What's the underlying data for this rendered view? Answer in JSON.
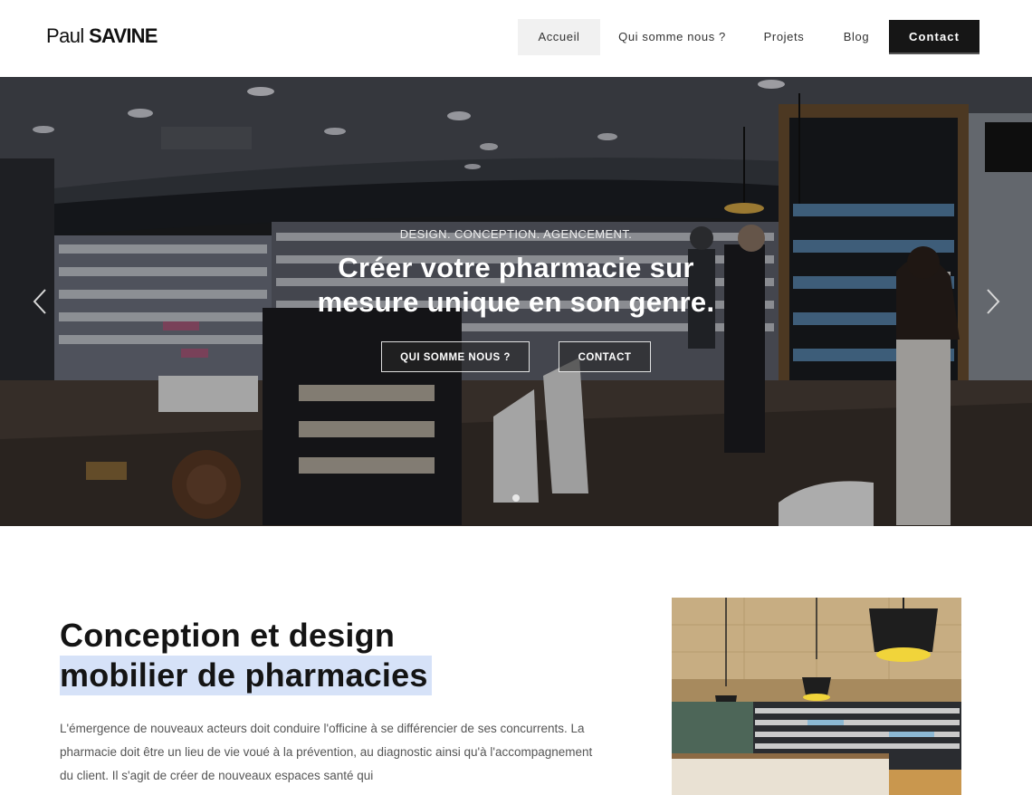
{
  "brand": {
    "first": "Paul",
    "last": "SAVINE"
  },
  "nav": {
    "items": [
      {
        "label": "Accueil",
        "active": true
      },
      {
        "label": "Qui somme nous ?"
      },
      {
        "label": "Projets"
      },
      {
        "label": "Blog"
      }
    ],
    "contact": "Contact"
  },
  "hero": {
    "kicker": "DESIGN. CONCEPTION. AGENCEMENT.",
    "title_line1": "Créer votre pharmacie sur",
    "title_line2": "mesure unique en son genre.",
    "btn_about": "QUI SOMME NOUS ?",
    "btn_contact": "CONTACT",
    "prev_icon": "chevron-left-icon",
    "next_icon": "chevron-right-icon"
  },
  "intro": {
    "heading_line1": "Conception et design",
    "heading_line2": "mobilier de pharmacies",
    "paragraph": "L'émergence de nouveaux acteurs doit conduire l'officine à se différencier de ses concurrents. La pharmacie doit être un lieu de vie voué à la prévention, au diagnostic ainsi qu'à l'accompagnement du client. Il s'agit de créer de nouveaux espaces santé qui"
  },
  "colors": {
    "accent": "#161616",
    "highlight": "#d6e2f8",
    "nav_active_bg": "#f1f1f1"
  }
}
